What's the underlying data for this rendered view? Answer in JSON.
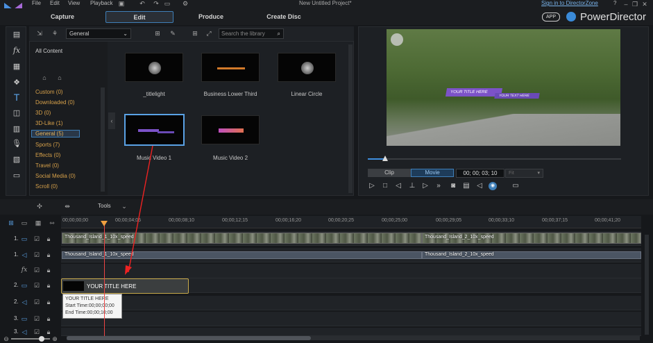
{
  "titlebar": {
    "menus": [
      "File",
      "Edit",
      "View",
      "Playback"
    ],
    "project_title": "New Untitled Project*",
    "signin_link": "Sign in to DirectorZone",
    "help_label": "?"
  },
  "modes": {
    "capture": "Capture",
    "edit": "Edit",
    "produce": "Produce",
    "create_disc": "Create Disc",
    "active": "Edit"
  },
  "brand": {
    "app_badge": "APP",
    "name": "PowerDirector"
  },
  "library": {
    "category_select": "General",
    "search_placeholder": "Search the library",
    "all_content": "All Content",
    "categories": [
      {
        "label": "Custom  (0)"
      },
      {
        "label": "Downloaded  (0)"
      },
      {
        "label": "3D  (0)"
      },
      {
        "label": "3D-Like  (1)"
      },
      {
        "label": "General  (5)",
        "selected": true
      },
      {
        "label": "Sports  (7)"
      },
      {
        "label": "Effects  (0)"
      },
      {
        "label": "Travel  (0)"
      },
      {
        "label": "Social Media  (0)"
      },
      {
        "label": "Scroll  (0)"
      }
    ],
    "templates": [
      {
        "label": "_titlelight"
      },
      {
        "label": "Business Lower Third"
      },
      {
        "label": "Linear Circle"
      },
      {
        "label": "Music Video 1",
        "selected": true
      },
      {
        "label": "Music Video 2"
      }
    ]
  },
  "preview": {
    "overlay_title": "YOUR TITLE HERE",
    "overlay_subtitle": "YOUR TEXT HERE",
    "clip_tab": "Clip",
    "movie_tab": "Movie",
    "timecode": "00; 00; 03; 10",
    "fps": "Fit"
  },
  "timeline": {
    "tools_label": "Tools",
    "ruler": [
      "00;00;00;00",
      "00;00;04;05",
      "00;00;08;10",
      "00;00;12;15",
      "00;00;16;20",
      "00;00;20;25",
      "00;00;25;00",
      "00;00;29;05",
      "00;00;33;10",
      "00;00;37;15",
      "00;00;41;20"
    ],
    "tracks": [
      {
        "num": "1.",
        "type": "video"
      },
      {
        "num": "1.",
        "type": "audio"
      },
      {
        "num": "fx",
        "type": "fx"
      },
      {
        "num": "2.",
        "type": "video"
      },
      {
        "num": "2.",
        "type": "audio"
      },
      {
        "num": "3.",
        "type": "video"
      },
      {
        "num": "3.",
        "type": "audio"
      }
    ],
    "clips": {
      "video_1a": "Thousand_Island_1_10x_speed",
      "video_1b": "Thousand_Island_2_10x_speed",
      "audio_1a": "Thousand_Island_1_10x_speed",
      "audio_1b": "Thousand_Island_2_10x_speed",
      "title_clip": "YOUR TITLE HERE"
    },
    "tooltip": {
      "title": "YOUR TITLE HERE",
      "start": "Start Time:00;00;00;00",
      "end": "End Time:00;00;10;00"
    }
  },
  "colors": {
    "accent_blue": "#3f7fb8",
    "category_orange": "#d7a14a",
    "playhead_red": "#e44444",
    "title_purple": "#7c52c8",
    "clip_border_gold": "#c8a94a"
  }
}
